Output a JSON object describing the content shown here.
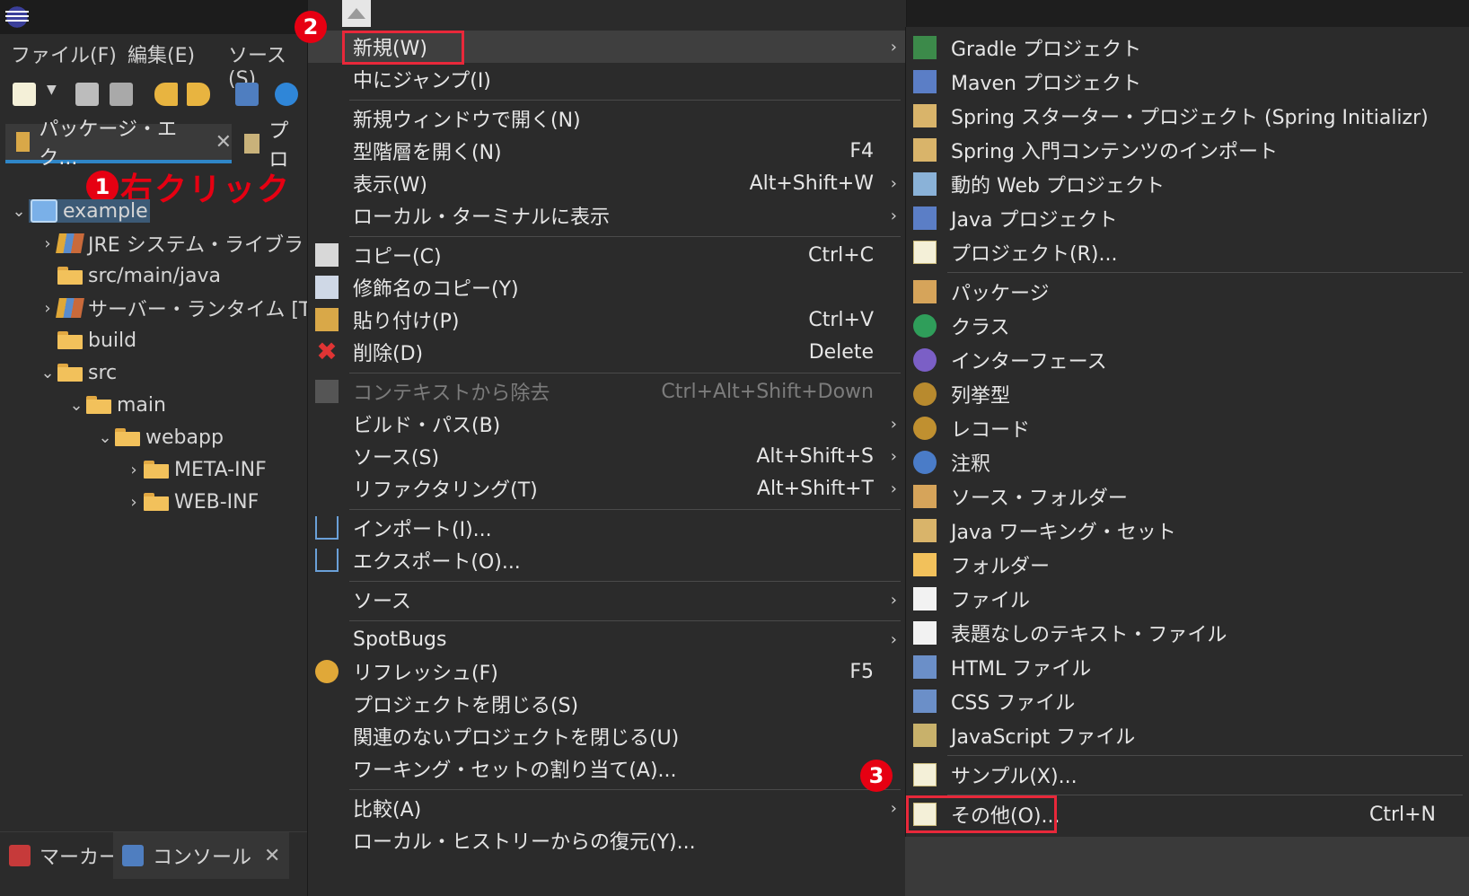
{
  "menubar": {
    "file": "ファイル(F)",
    "edit": "編集(E)",
    "source": "ソース(S)"
  },
  "view_tabs": {
    "package_explorer": "パッケージ・エク...",
    "second": "プロ"
  },
  "annotations": {
    "one": "1",
    "one_text": "右クリック",
    "two": "2",
    "three": "3"
  },
  "tree": [
    {
      "label": "example"
    },
    {
      "label": "JRE システム・ライブラリー"
    },
    {
      "label": "src/main/java"
    },
    {
      "label": "サーバー・ランタイム [Tomc"
    },
    {
      "label": "build"
    },
    {
      "label": "src"
    },
    {
      "label": "main"
    },
    {
      "label": "webapp"
    },
    {
      "label": "META-INF"
    },
    {
      "label": "WEB-INF"
    }
  ],
  "bottom_tabs": {
    "markers": "マーカー",
    "console": "コンソール"
  },
  "context_menu": [
    {
      "label": "新規(W)",
      "shortcut": ""
    },
    {
      "label": "中にジャンプ(I)",
      "shortcut": ""
    },
    {
      "label": "新規ウィンドウで開く(N)",
      "shortcut": ""
    },
    {
      "label": "型階層を開く(N)",
      "shortcut": "F4"
    },
    {
      "label": "表示(W)",
      "shortcut": "Alt+Shift+W"
    },
    {
      "label": "ローカル・ターミナルに表示",
      "shortcut": ""
    },
    {
      "label": "コピー(C)",
      "shortcut": "Ctrl+C"
    },
    {
      "label": "修飾名のコピー(Y)",
      "shortcut": ""
    },
    {
      "label": "貼り付け(P)",
      "shortcut": "Ctrl+V"
    },
    {
      "label": "削除(D)",
      "shortcut": "Delete"
    },
    {
      "label": "コンテキストから除去",
      "shortcut": "Ctrl+Alt+Shift+Down"
    },
    {
      "label": "ビルド・パス(B)",
      "shortcut": ""
    },
    {
      "label": "ソース(S)",
      "shortcut": "Alt+Shift+S"
    },
    {
      "label": "リファクタリング(T)",
      "shortcut": "Alt+Shift+T"
    },
    {
      "label": "インポート(I)...",
      "shortcut": ""
    },
    {
      "label": "エクスポート(O)...",
      "shortcut": ""
    },
    {
      "label": "ソース",
      "shortcut": ""
    },
    {
      "label": "SpotBugs",
      "shortcut": ""
    },
    {
      "label": "リフレッシュ(F)",
      "shortcut": "F5"
    },
    {
      "label": "プロジェクトを閉じる(S)",
      "shortcut": ""
    },
    {
      "label": "関連のないプロジェクトを閉じる(U)",
      "shortcut": ""
    },
    {
      "label": "ワーキング・セットの割り当て(A)...",
      "shortcut": ""
    },
    {
      "label": "比較(A)",
      "shortcut": ""
    },
    {
      "label": "ローカル・ヒストリーからの復元(Y)...",
      "shortcut": ""
    }
  ],
  "submenu": [
    {
      "label": "Gradle プロジェクト"
    },
    {
      "label": "Maven プロジェクト"
    },
    {
      "label": "Spring スターター・プロジェクト (Spring Initializr)"
    },
    {
      "label": "Spring 入門コンテンツのインポート"
    },
    {
      "label": "動的 Web プロジェクト"
    },
    {
      "label": "Java プロジェクト"
    },
    {
      "label": "プロジェクト(R)..."
    },
    {
      "label": "パッケージ"
    },
    {
      "label": "クラス"
    },
    {
      "label": "インターフェース"
    },
    {
      "label": "列挙型"
    },
    {
      "label": "レコード"
    },
    {
      "label": "注釈"
    },
    {
      "label": "ソース・フォルダー"
    },
    {
      "label": "Java ワーキング・セット"
    },
    {
      "label": "フォルダー"
    },
    {
      "label": "ファイル"
    },
    {
      "label": "表題なしのテキスト・ファイル"
    },
    {
      "label": "HTML ファイル"
    },
    {
      "label": "CSS ファイル"
    },
    {
      "label": "JavaScript ファイル"
    },
    {
      "label": "サンプル(X)..."
    },
    {
      "label": "その他(O)...",
      "shortcut": "Ctrl+N"
    }
  ],
  "colors": {
    "annotation_red": "#e60012",
    "highlight_box": "#e8283a",
    "background": "#2b2b2b"
  }
}
